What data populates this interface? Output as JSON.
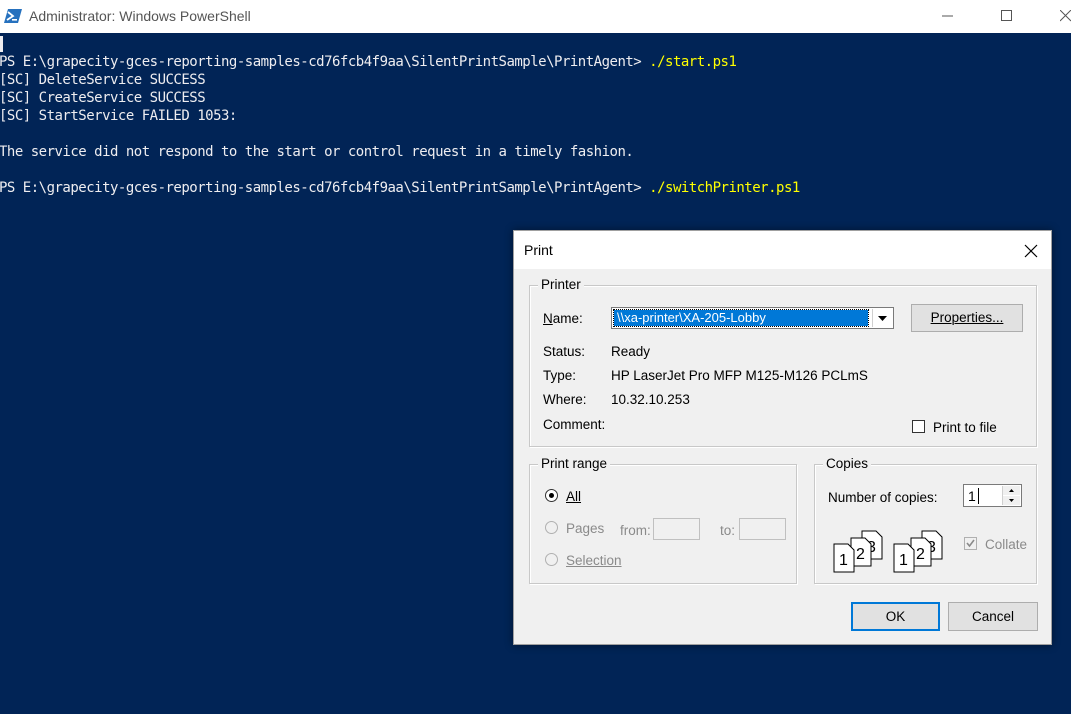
{
  "window": {
    "title": "Administrator: Windows PowerShell",
    "app_icon": "powershell-icon",
    "controls": [
      "minimize-icon",
      "maximize-icon",
      "close-icon"
    ]
  },
  "console": {
    "lines": [
      {
        "prompt": "PS E:\\grapecity-gces-reporting-samples-cd76fcb4f9aa\\SilentPrintSample\\PrintAgent> ",
        "command": "./start.ps1"
      },
      {
        "text": "[SC] DeleteService SUCCESS"
      },
      {
        "text": "[SC] CreateService SUCCESS"
      },
      {
        "text": "[SC] StartService FAILED 1053:"
      },
      {
        "text": ""
      },
      {
        "text": "The service did not respond to the start or control request in a timely fashion."
      },
      {
        "text": ""
      },
      {
        "prompt": "PS E:\\grapecity-gces-reporting-samples-cd76fcb4f9aa\\SilentPrintSample\\PrintAgent> ",
        "command": "./switchPrinter.ps1"
      }
    ],
    "colors": {
      "background": "#012456",
      "text": "#eeedf0",
      "command": "#ffff00"
    }
  },
  "print_dialog": {
    "title": "Print",
    "printer": {
      "group_label": "Printer",
      "name_label": "Name:",
      "name_value": "\\\\xa-printer\\XA-205-Lobby",
      "properties_button": "Properties...",
      "status_label": "Status:",
      "status_value": "Ready",
      "type_label": "Type:",
      "type_value": "HP LaserJet Pro MFP M125-M126 PCLmS",
      "where_label": "Where:",
      "where_value": "10.32.10.253",
      "comment_label": "Comment:",
      "comment_value": "",
      "print_to_file_label": "Print to file",
      "print_to_file_checked": false
    },
    "print_range": {
      "group_label": "Print range",
      "all_label": "All",
      "pages_label": "Pages",
      "from_label": "from:",
      "to_label": "to:",
      "from_value": "",
      "to_value": "",
      "selection_label": "Selection",
      "selected": "All"
    },
    "copies": {
      "group_label": "Copies",
      "number_label": "Number of copies:",
      "number_value": "1",
      "collate_label": "Collate",
      "collate_checked": true,
      "collate_icon": "collate-pages-icon"
    },
    "ok_button": "OK",
    "cancel_button": "Cancel",
    "accent_color": "#0078d7"
  }
}
